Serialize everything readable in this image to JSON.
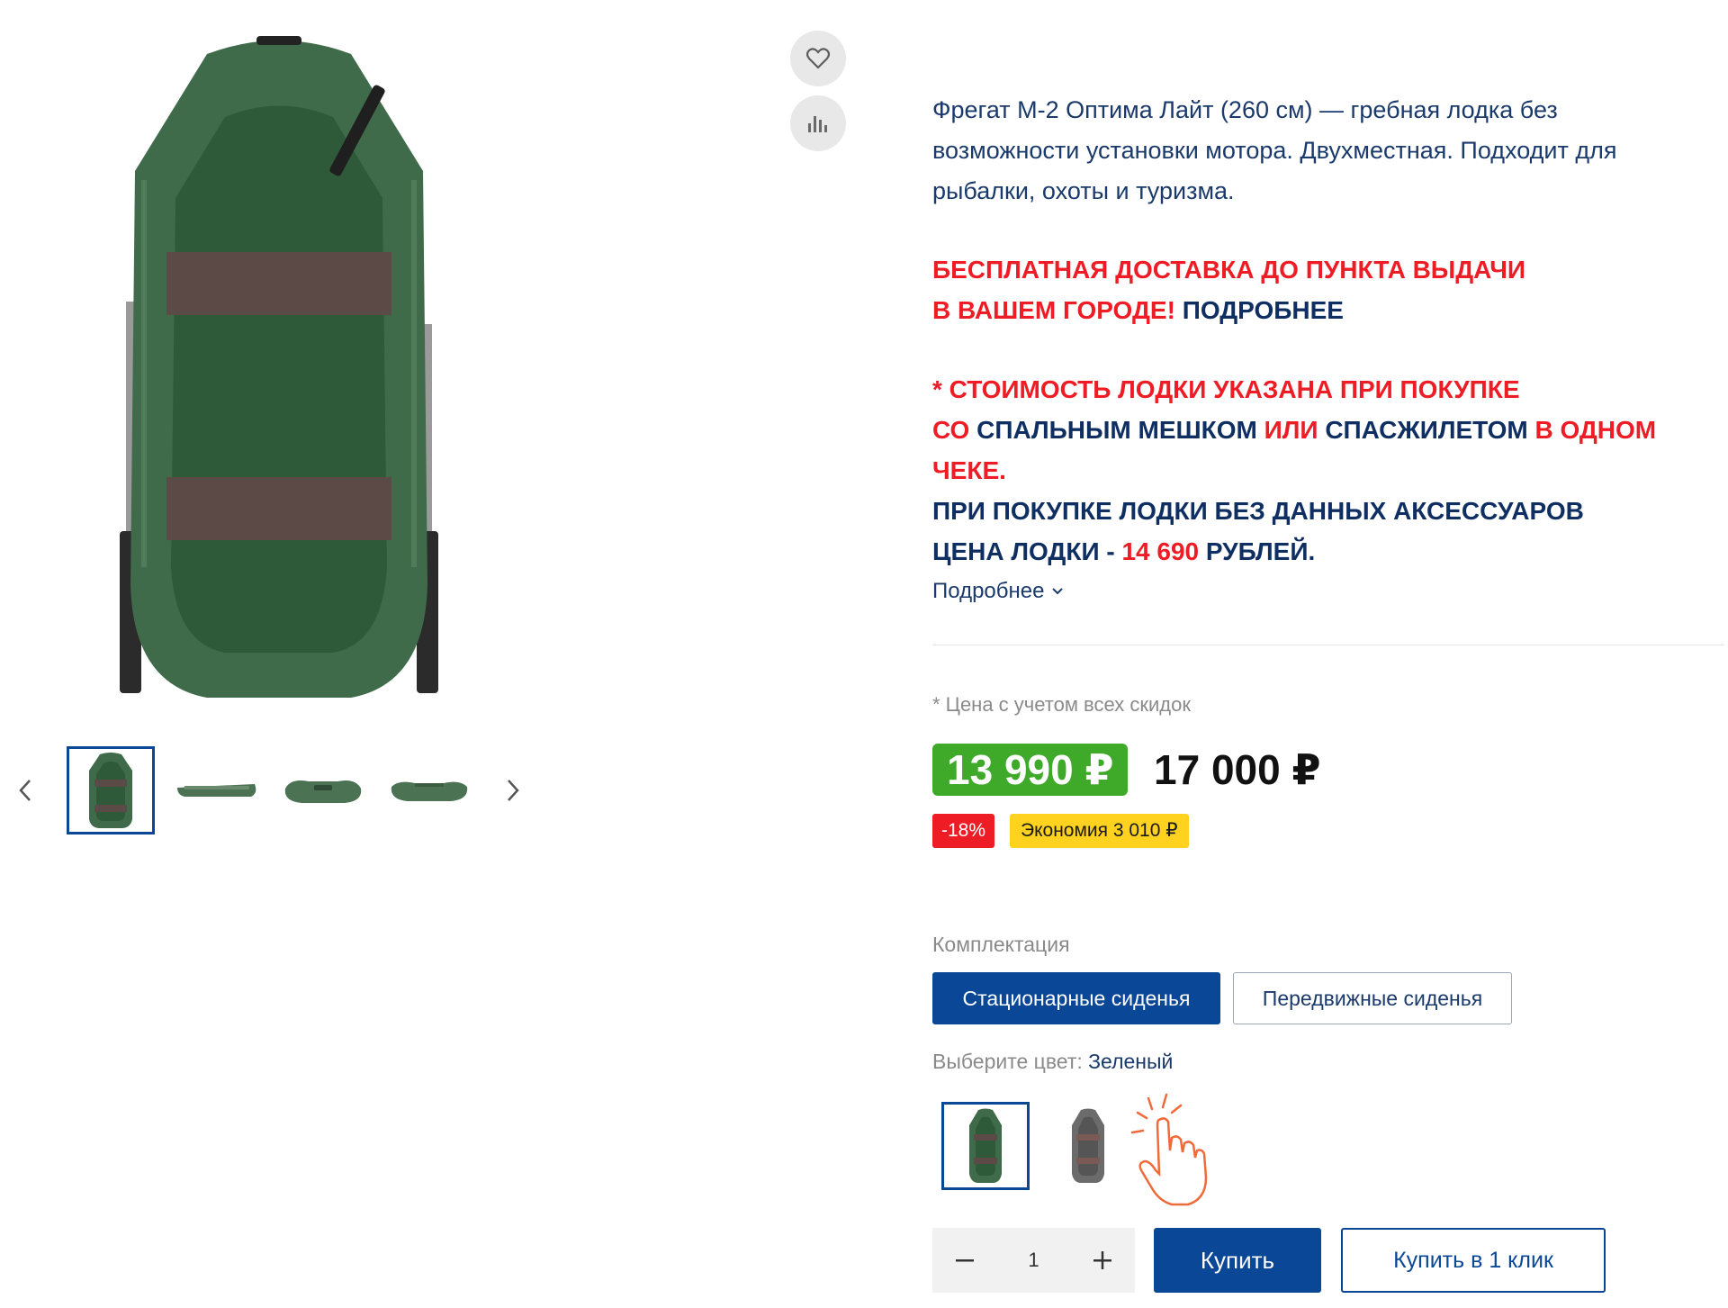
{
  "gallery": {
    "main_image_alt": "",
    "thumb_count": 4
  },
  "description": {
    "text": "Фрегат М-2 Оптима Лайт (260 см) — гребная лодка без возможности установки мотора. Двухместная. Подходит для рыбалки, охоты и туризма."
  },
  "promo1": {
    "part1": "БЕСПЛАТНАЯ ДОСТАВКА ДО ПУНКТА ВЫДАЧИ",
    "part2": "В ВАШЕМ ГОРОДЕ!",
    "link": "ПОДРОБНЕЕ"
  },
  "promo2": {
    "line1": "* СТОИМОСТЬ ЛОДКИ УКАЗАНА ПРИ ПОКУПКЕ",
    "so": "СО",
    "sleeping_bag": "СПАЛЬНЫМ МЕШКОМ",
    "or": "ИЛИ",
    "life_vest": "СПАСЖИЛЕТОМ",
    "one_receipt": "В ОДНОМ ЧЕКЕ.",
    "line4": "ПРИ ПОКУПКЕ ЛОДКИ БЕЗ ДАННЫХ АКСЕССУАРОВ",
    "price_prefix": "ЦЕНА ЛОДКИ -",
    "price_value": "14 690",
    "price_suffix": "РУБЛЕЙ."
  },
  "more_link": "Подробнее",
  "price": {
    "note": "* Цена с учетом всех скидок",
    "current": "13 990 ₽",
    "old": "17 000 ₽",
    "discount": "-18%",
    "saving": "Экономия 3 010 ₽"
  },
  "options": {
    "config_label": "Комплектация",
    "config": [
      "Стационарные сиденья",
      "Передвижные сиденья"
    ],
    "color_label": "Выберите цвет:",
    "color_value": "Зеленый"
  },
  "purchase": {
    "quantity": "1",
    "buy": "Купить",
    "one_click": "Купить в 1 клик"
  },
  "colors": {
    "accent": "#0a4796",
    "price_green": "#3fa92a",
    "promo_red": "#ee1c25",
    "saving_yellow": "#ffd21f",
    "boat_green": "#3f6b4a"
  }
}
